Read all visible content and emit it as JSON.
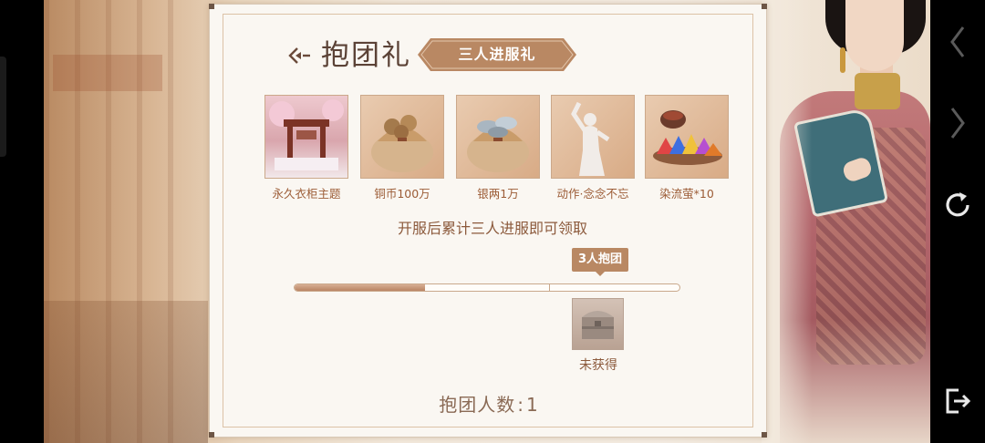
{
  "panel": {
    "title": "抱团礼",
    "ribbon_label": "三人进服礼",
    "notice": "开服后累计三人进服即可领取",
    "rewards": [
      {
        "label": "永久衣柜主题",
        "icon": "wardrobe-gate-icon"
      },
      {
        "label": "铜币100万",
        "icon": "copper-coin-bag-icon"
      },
      {
        "label": "银两1万",
        "icon": "silver-ingot-bag-icon"
      },
      {
        "label": "动作·念念不忘",
        "icon": "pose-silhouette-icon"
      },
      {
        "label": "染流萤*10",
        "icon": "dye-powder-icon"
      }
    ],
    "milestone": {
      "tag": "3人抱团",
      "status": "未获得",
      "icon": "treasure-chest-icon"
    },
    "progress": {
      "value": 0.34
    },
    "count_label": "抱团人数",
    "count_value": "1"
  },
  "side_buttons": [
    "chevron-left-icon",
    "chevron-right-icon",
    "refresh-icon",
    "exit-icon"
  ],
  "colors": {
    "accent": "#b98863",
    "title": "#5b4236",
    "label": "#9c5c36"
  }
}
